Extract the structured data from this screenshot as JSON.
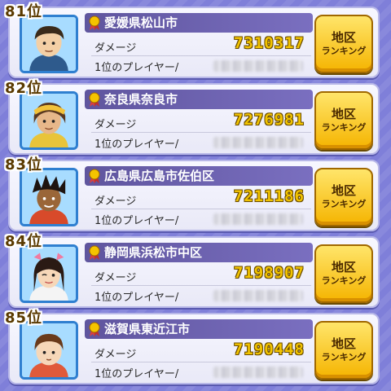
{
  "list": {
    "entries": [
      {
        "rank": "81位",
        "region": "愛媛県松山市",
        "damage_label": "ダメージ",
        "damage": "7310317",
        "player_label": "1位のプレイヤー/",
        "button_line1": "地区",
        "button_line2": "ランキング",
        "avatar": "boy-short-hair-avatar"
      },
      {
        "rank": "82位",
        "region": "奈良県奈良市",
        "damage_label": "ダメージ",
        "damage": "7276981",
        "player_label": "1位のプレイヤー/",
        "button_line1": "地区",
        "button_line2": "ランキング",
        "avatar": "boy-bandana-avatar"
      },
      {
        "rank": "83位",
        "region": "広島県広島市佐伯区",
        "damage_label": "ダメージ",
        "damage": "7211186",
        "player_label": "1位のプレイヤー/",
        "button_line1": "地区",
        "button_line2": "ランキング",
        "avatar": "boy-spiky-hair-avatar"
      },
      {
        "rank": "84位",
        "region": "静岡県浜松市中区",
        "damage_label": "ダメージ",
        "damage": "7198907",
        "player_label": "1位のプレイヤー/",
        "button_line1": "地区",
        "button_line2": "ランキング",
        "avatar": "girl-bow-avatar"
      },
      {
        "rank": "85位",
        "region": "滋賀県東近江市",
        "damage_label": "ダメージ",
        "damage": "7190448",
        "player_label": "1位のプレイヤー/",
        "button_line1": "地区",
        "button_line2": "ランキング",
        "avatar": "boy-round-face-avatar"
      }
    ]
  },
  "colors": {
    "background": "#7f7fd9",
    "region_bar": "#6a5fa8",
    "damage_text": "#f2c400",
    "button_fill": "#f5b400"
  }
}
